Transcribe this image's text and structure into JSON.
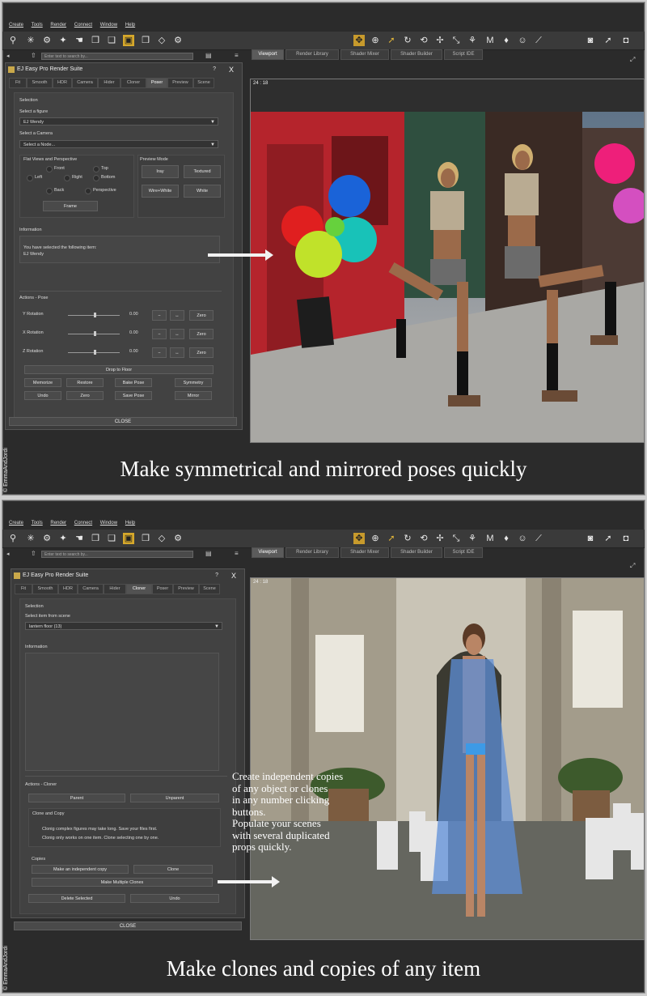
{
  "menu": [
    "Create",
    "Tools",
    "Render",
    "Connect",
    "Window",
    "Help"
  ],
  "search_placeholder": "Enter text to search by...",
  "view_tabs": [
    "Viewport",
    "Render Library",
    "Shader Mixer",
    "Shader Builder",
    "Script IDE"
  ],
  "viewport_label": "24 : 18",
  "dialog_title": "EJ Easy Pro Render Suite",
  "dialog_help": "?",
  "dialog_close": "X",
  "close_button": "CLOSE",
  "copyright": "© EmmaAndJordi",
  "panel1": {
    "tabs": [
      "Fit",
      "Smooth",
      "HDR",
      "Camera",
      "Hider",
      "Cloner",
      "Poser",
      "Preview",
      "Scene"
    ],
    "active_tab": 6,
    "selection_label": "Selection",
    "figure_label": "Select a figure",
    "figure_value": "EJ Wendy",
    "camera_label": "Select a Camera",
    "camera_value": "Select a Node...",
    "flat_views_label": "Flat Views and Perspective",
    "views": {
      "front": "Front",
      "top": "Top",
      "left": "Left",
      "right": "Right",
      "bottom": "Bottom",
      "back": "Back",
      "perspective": "Perspective"
    },
    "frame": "Frame",
    "preview_mode_label": "Preview Mode",
    "preview_modes": [
      "Iray",
      "Textured",
      "Wire+White",
      "White"
    ],
    "information_label": "Information",
    "info_line1": "You have selected the following item:",
    "info_line2": "EJ Wendy",
    "actions_label": "Actions - Pose",
    "rotations": [
      {
        "label": "Y Rotation",
        "value": "0.00"
      },
      {
        "label": "X Rotation",
        "value": "0.00"
      },
      {
        "label": "Z Rotation",
        "value": "0.00"
      }
    ],
    "minus": "−",
    "swap": "↔",
    "zero": "Zero",
    "drop_to_floor": "Drop to Floor",
    "pose_buttons": [
      "Memorize",
      "Restore",
      "Bake Pose",
      "Symmetry",
      "Undo",
      "Zero",
      "Save Pose",
      "Mirror"
    ],
    "caption": "Make symmetrical and mirrored poses quickly"
  },
  "panel2": {
    "tabs": [
      "Fit",
      "Smooth",
      "HDR",
      "Camera",
      "Hider",
      "Cloner",
      "Poser",
      "Preview",
      "Scene"
    ],
    "active_tab": 5,
    "selection_label": "Selection",
    "select_item_label": "Select item from scene",
    "select_item_value": "lantern floor (13)",
    "information_label": "Information",
    "actions_label": "Actions - Cloner",
    "parent": "Parent",
    "unparent": "Unparent",
    "clone_copy_label": "Clone and Copy",
    "note1": "Clonig complex figures may take long. Save your files first.",
    "note2": "Clonig only works on one item. Clone selecting one by one.",
    "copies_label": "Copies",
    "make_copy": "Make an independent copy",
    "clone": "Clone",
    "make_multiple": "Make Multiple Clones",
    "delete_selected": "Delete Selected",
    "undo": "Undo",
    "annotation": [
      "Create independent copies",
      "of any object or clones",
      "in any number clicking",
      "buttons.",
      "Populate your scenes",
      "with several duplicated",
      "props quickly."
    ],
    "caption": "Make clones and copies of any item"
  }
}
